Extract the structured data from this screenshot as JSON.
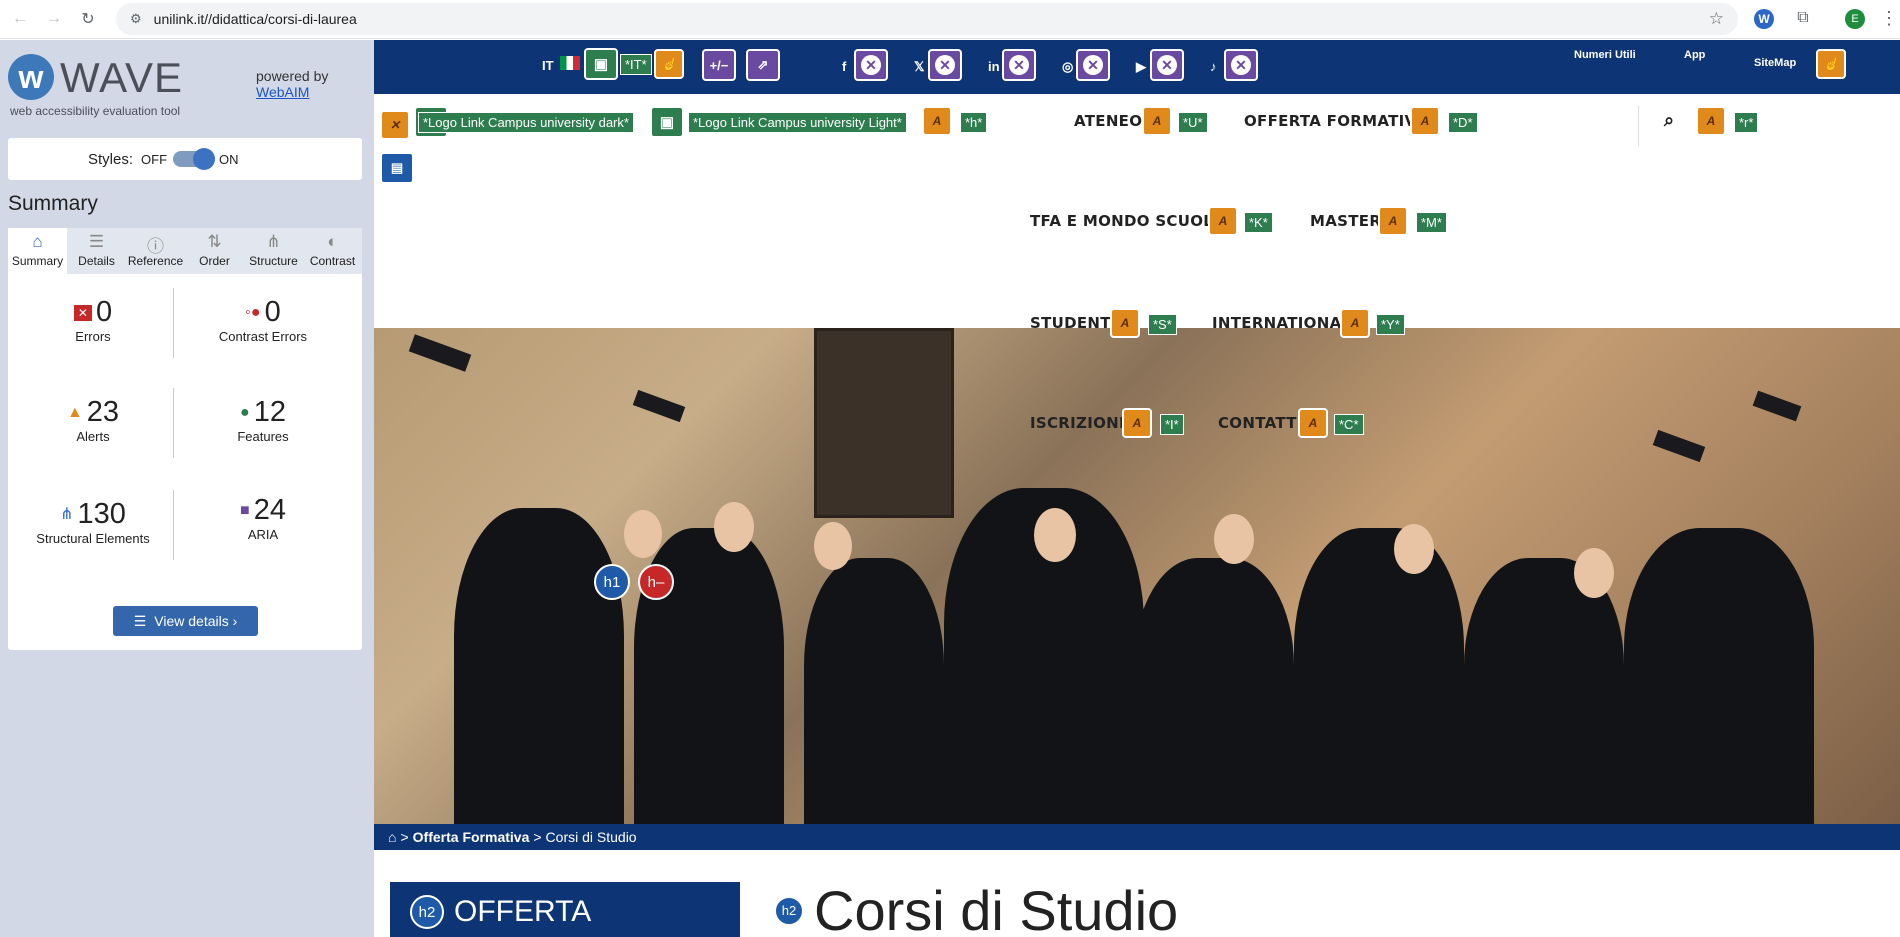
{
  "browser": {
    "url": "unilink.it//didattica/corsi-di-laurea",
    "profile_initial": "E"
  },
  "wave": {
    "title": "WAVE",
    "tagline": "web accessibility evaluation tool",
    "powered_by": "powered by",
    "webaim": "WebAIM",
    "styles_label": "Styles:",
    "styles_off": "OFF",
    "styles_on": "ON",
    "summary_heading": "Summary",
    "tabs": [
      {
        "label": "Summary",
        "icon": "home-icon"
      },
      {
        "label": "Details",
        "icon": "list-icon"
      },
      {
        "label": "Reference",
        "icon": "info-icon"
      },
      {
        "label": "Order",
        "icon": "order-icon"
      },
      {
        "label": "Structure",
        "icon": "structure-icon"
      },
      {
        "label": "Contrast",
        "icon": "contrast-icon"
      }
    ],
    "stats": {
      "errors": {
        "value": "0",
        "label": "Errors"
      },
      "contrast_errors": {
        "value": "0",
        "label": "Contrast Errors"
      },
      "alerts": {
        "value": "23",
        "label": "Alerts"
      },
      "features": {
        "value": "12",
        "label": "Features"
      },
      "structural": {
        "value": "130",
        "label": "Structural Elements"
      },
      "aria": {
        "value": "24",
        "label": "ARIA"
      }
    },
    "view_details": "View details ›"
  },
  "site": {
    "lang": "IT",
    "lang_label": "*IT*",
    "top_links": {
      "numeri": "Numeri Utili",
      "app": "App",
      "sitemap": "SiteMap"
    },
    "logo_dark": "*Logo Link Campus university dark*",
    "logo_light": "*Logo Link Campus university Light*",
    "menu": {
      "h": "*h*",
      "ateneo": "ATENEO",
      "ateneo_key": "*U*",
      "offerta": "OFFERTA FORMATIVA",
      "offerta_key": "*D*",
      "search_key": "*r*",
      "tfa": "TFA E MONDO SCUOLA",
      "tfa_key": "*K*",
      "master": "MASTER",
      "master_key": "*M*",
      "studenti": "STUDENTI",
      "studenti_key": "*S*",
      "international": "INTERNATIONAL",
      "international_key": "*Y*",
      "iscrizione": "ISCRIZIONE",
      "iscrizione_key": "*I*",
      "contatti": "CONTATTI",
      "contatti_key": "*C*"
    },
    "breadcrumb": {
      "sep": ">",
      "section": "Offerta Formativa",
      "current": "Corsi di Studio"
    },
    "sidebar_heading": "OFFERTA",
    "page_heading": "Corsi di Studio",
    "h2": "h2",
    "h1": "h1",
    "h_empty": "h–"
  }
}
